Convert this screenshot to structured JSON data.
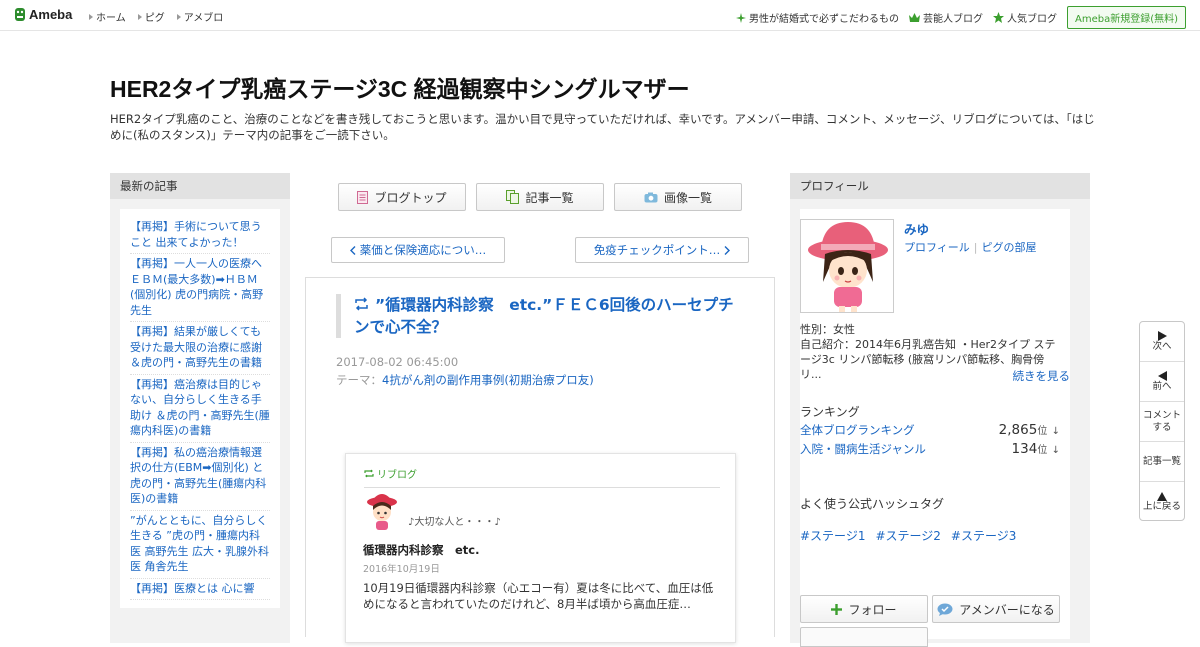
{
  "topbar": {
    "logo": "Ameba",
    "nav": [
      "ホーム",
      "ピグ",
      "アメブロ"
    ],
    "right_links": [
      {
        "icon": "sparkle-icon",
        "label": "男性が結婚式で必ずこだわるもの"
      },
      {
        "icon": "crown-icon",
        "label": "芸能人ブログ"
      },
      {
        "icon": "star-icon",
        "label": "人気ブログ"
      }
    ],
    "register": "Ameba新規登録(無料)"
  },
  "header": {
    "title": "HER2タイプ乳癌ステージ3C 経過観察中シングルマザー",
    "description": "HER2タイプ乳癌のこと、治療のことなどを書き残しておこうと思います。温かい目で見守っていただければ、幸いです。アメンバー申請、コメント、メッセージ、リブログについては、「はじめに(私のスタンス)」テーマ内の記事をご一読下さい。"
  },
  "sidebar": {
    "heading": "最新の記事",
    "items": [
      "【再掲】手術について思うこと 出来てよかった！",
      "【再掲】一人一人の医療へ ＥＢＭ(最大多数)➡ＨＢＭ(個別化) 虎の門病院・高野先生",
      "【再掲】結果が厳しくても受けた最大限の治療に感謝 ＆虎の門・高野先生の書籍",
      "【再掲】癌治療は目的じゃない、自分らしく生きる手助け ＆虎の門・高野先生(腫瘍内科医)の書籍",
      "【再掲】私の癌治療情報選択の仕方(EBM➡個別化) と虎の門・高野先生(腫瘍内科医)の書籍",
      "”がんとともに、自分らしく生きる ”虎の門・腫瘍内科医 高野先生 広大・乳腺外科医 角舎先生",
      "【再掲】医療とは 心に響"
    ]
  },
  "main": {
    "buttons": [
      {
        "icon": "document-icon",
        "label": "ブログトップ"
      },
      {
        "icon": "copy-icon",
        "label": "記事一覧"
      },
      {
        "icon": "camera-icon",
        "label": "画像一覧"
      }
    ],
    "prev": "薬価と保険適応につい…",
    "next": "免疫チェックポイント…",
    "article": {
      "title": "”循環器内科診察　etc.”ＦＥＣ6回後のハーセプチンで心不全？",
      "date": "2017-08-02 06:45:00",
      "theme_prefix": "テーマ：",
      "theme": "4抗がん剤の副作用事例(初期治療プロ友)"
    },
    "reblog": {
      "label": "リブログ",
      "user": "♪大切な人と・・・♪",
      "title": "循環器内科診察　etc.",
      "date": "2016年10月19日",
      "excerpt": "10月19日循環器内科診察（心エコー有）夏は冬に比べて、血圧は低めになると言われていたのだけれど、8月半ば頃から高血圧症…"
    }
  },
  "profile": {
    "heading": "プロフィール",
    "name": "みゆ",
    "link_profile": "プロフィール",
    "link_pig": "ピグの部屋",
    "gender": "性別：女性",
    "intro": "自己紹介：2014年6月乳癌告知 ・Her2タイプ ステージ3c リンパ節転移 (腋窩リンパ節転移、胸骨傍リ...",
    "more": "続きを見る",
    "ranking_heading": "ランキング",
    "rankings": [
      {
        "label": "全体ブログランキング",
        "value": "2,865",
        "unit": "位",
        "arrow": "↓"
      },
      {
        "label": "入院・闘病生活ジャンル",
        "value": "134",
        "unit": "位",
        "arrow": "↓"
      }
    ],
    "hashtag_heading": "よく使う公式ハッシュタグ",
    "hashtags": [
      "#ステージ1",
      "#ステージ2",
      "#ステージ3"
    ],
    "follow": "フォロー",
    "amember": "アメンバーになる"
  },
  "floatnav": {
    "next": "次へ",
    "prev": "前へ",
    "comment": "コメントする",
    "list": "記事一覧",
    "top": "上に戻る"
  },
  "colors": {
    "link": "#1a66c2",
    "brand_green": "#3c9f2f"
  }
}
